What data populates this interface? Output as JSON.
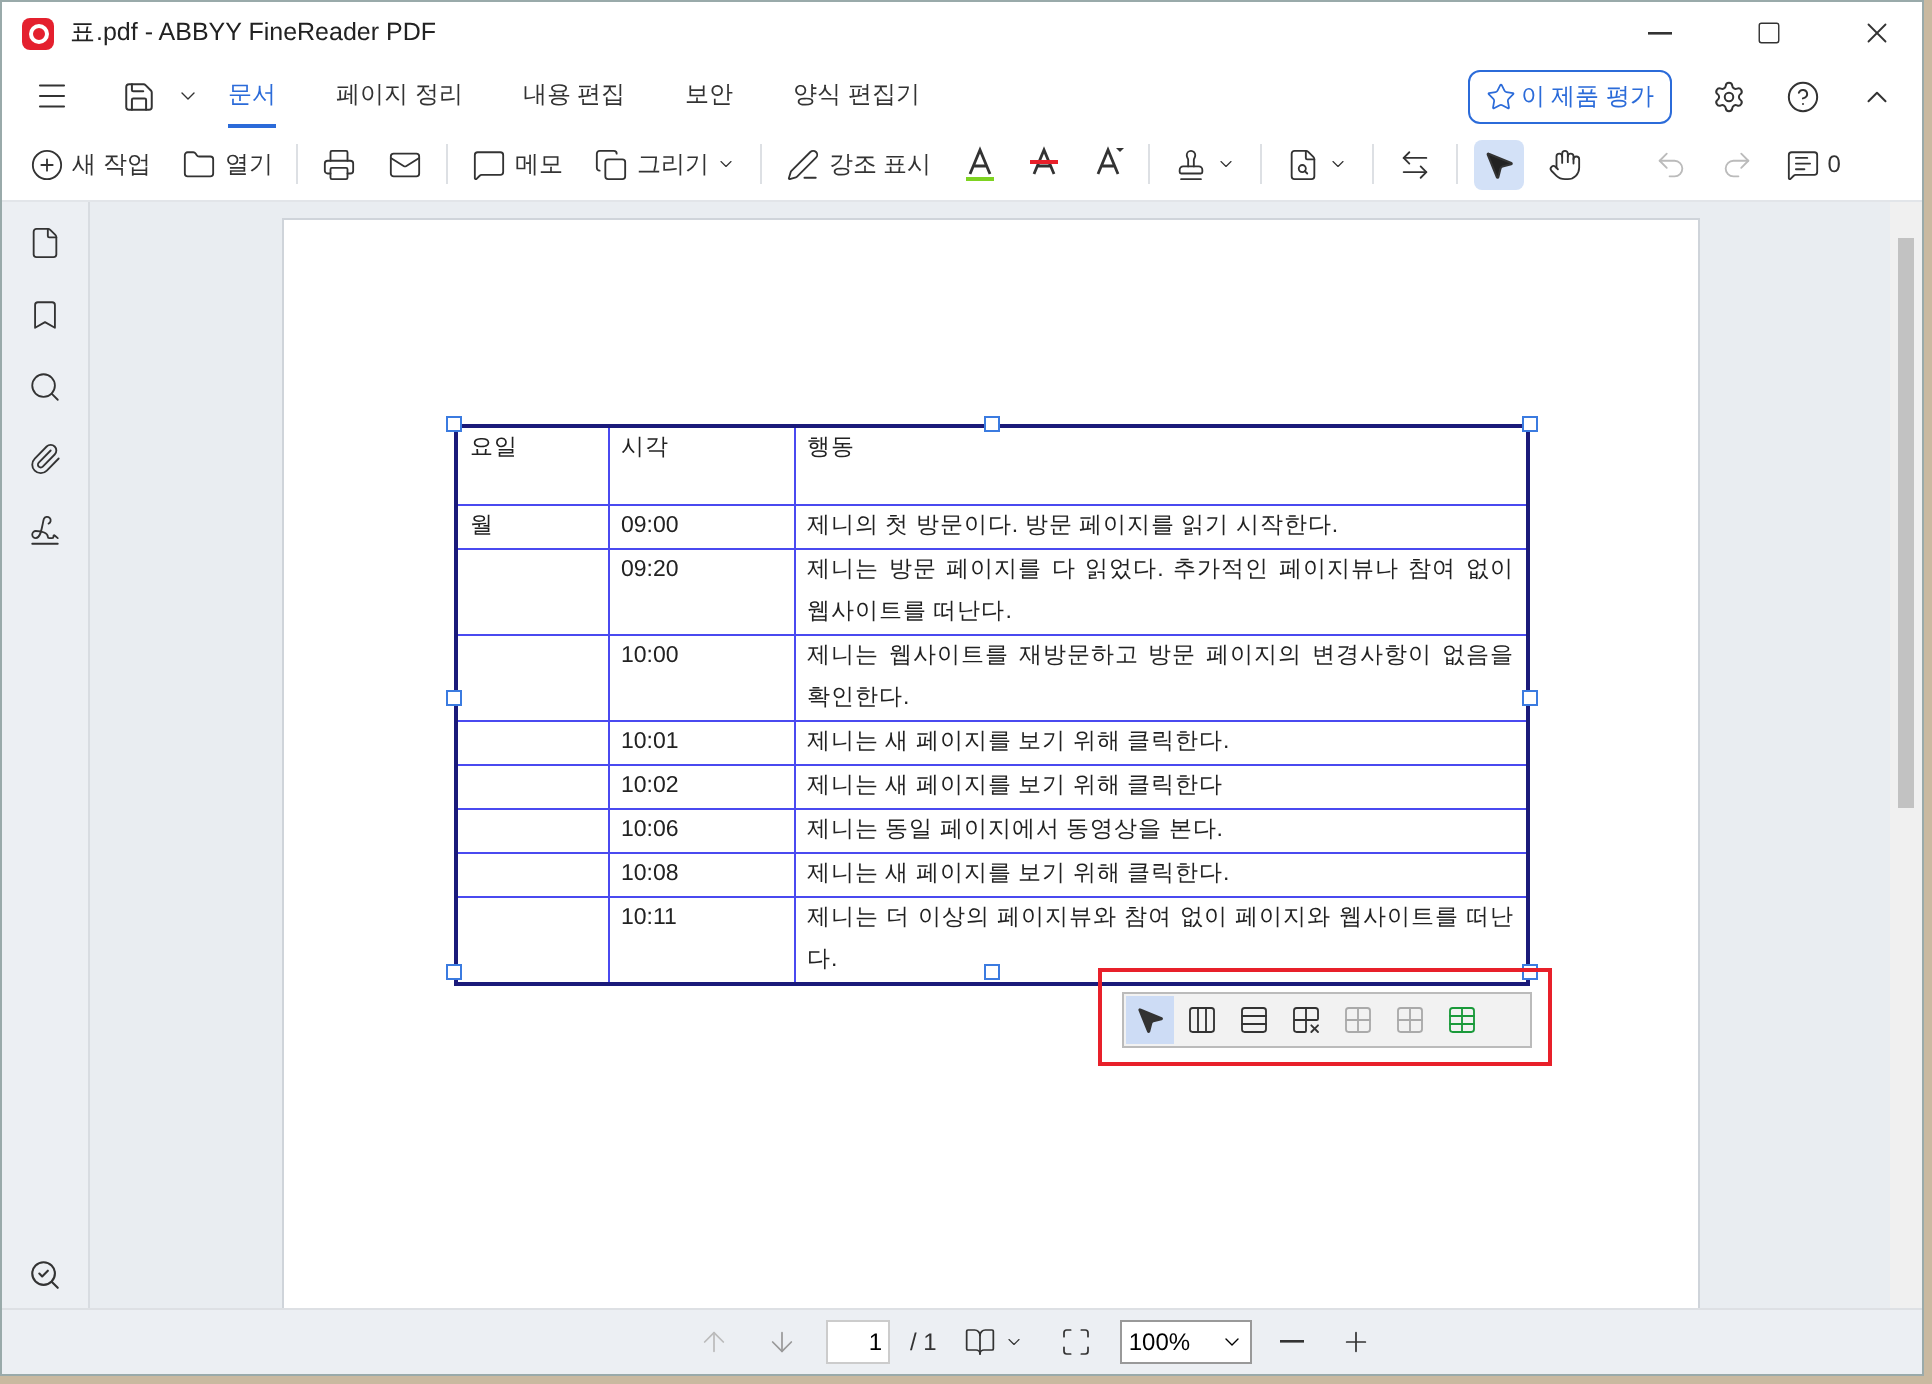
{
  "window": {
    "title": "표.pdf - ABBYY FineReader PDF"
  },
  "menu_tabs": [
    {
      "label": "문서",
      "selected": true
    },
    {
      "label": "페이지 정리",
      "selected": false
    },
    {
      "label": "내용 편집",
      "selected": false
    },
    {
      "label": "보안",
      "selected": false
    },
    {
      "label": "양식 편집기",
      "selected": false
    }
  ],
  "rate_button": "이 제품 평가",
  "toolbar": {
    "new_task": "새 작업",
    "open": "열기",
    "memo": "메모",
    "draw": "그리기",
    "highlight": "강조 표시",
    "comment_count": "0"
  },
  "tools": [
    {
      "selected": true
    },
    {
      "selected": false
    }
  ],
  "table": {
    "columns": [
      "요일",
      "시각",
      "행동"
    ],
    "rows": [
      {
        "day": "월",
        "time": "09:00",
        "action": "제니의 첫 방문이다. 방문 페이지를 읽기 시작한다."
      },
      {
        "time": "09:20",
        "action": "제니는 방문 페이지를 다 읽었다. 추가적인 페이지뷰나 참여 없이 웹사이트를 떠난다."
      },
      {
        "time": "10:00",
        "action": "제니는 웹사이트를 재방문하고 방문 페이지의 변경사항이 없음을 확인한다."
      },
      {
        "time": "10:01",
        "action": "제니는 새 페이지를 보기 위해 클릭한다."
      },
      {
        "time": "10:02",
        "action": "제니는 새 페이지를 보기 위해 클릭한다"
      },
      {
        "time": "10:06",
        "action": "제니는 동일 페이지에서 동영상을 본다."
      },
      {
        "time": "10:08",
        "action": "제니는 새 페이지를 보기 위해 클릭한다."
      },
      {
        "time": "10:11",
        "action": "제니는 더 이상의 페이지뷰와 참여 없이 페이지와 웹사이트를 떠난다."
      }
    ]
  },
  "table_tools": [
    {
      "selected": true,
      "disabled": false
    },
    {
      "selected": false,
      "disabled": false
    },
    {
      "selected": false,
      "disabled": false
    },
    {
      "selected": false,
      "disabled": false
    },
    {
      "selected": false,
      "disabled": true
    },
    {
      "selected": false,
      "disabled": true
    },
    {
      "selected": false,
      "disabled": false
    }
  ],
  "status_bar": {
    "page": "1",
    "page_total": "/ 1",
    "zoom": "100%"
  }
}
